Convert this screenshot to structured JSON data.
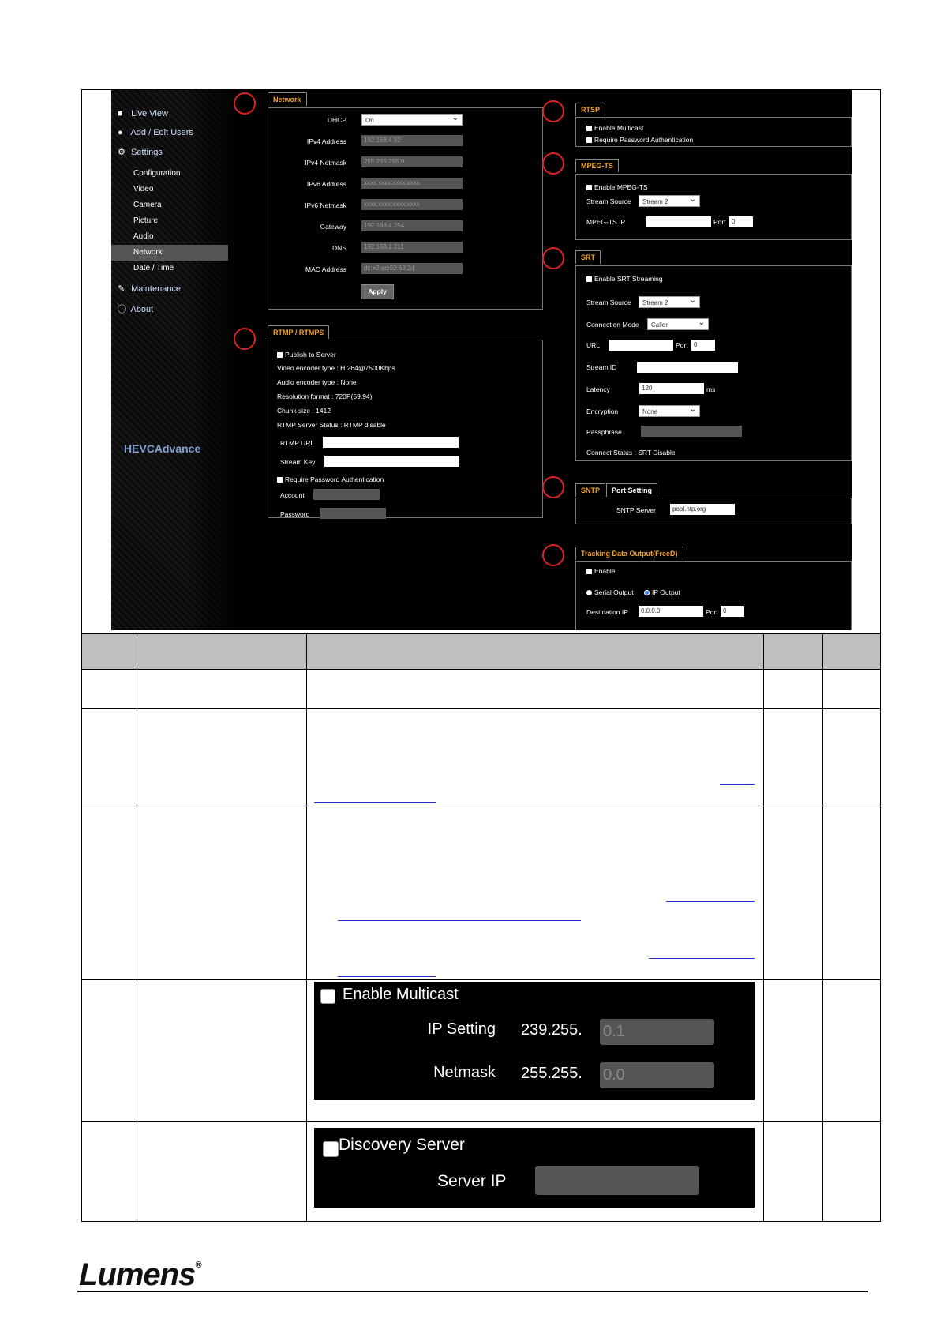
{
  "sidebar": {
    "items": [
      {
        "label": "Live View",
        "icon": "camera-icon"
      },
      {
        "label": "Add / Edit Users",
        "icon": "user-icon"
      },
      {
        "label": "Settings",
        "icon": "gear-icon"
      }
    ],
    "sub": [
      "Configuration",
      "Video",
      "Camera",
      "Picture",
      "Audio",
      "Network",
      "Date / Time"
    ],
    "active": "Network",
    "bottom": [
      {
        "label": "Maintenance",
        "icon": "wrench-icon"
      },
      {
        "label": "About",
        "icon": "info-icon"
      }
    ],
    "logo_text": "HEVCAdvance"
  },
  "network": {
    "tab": "Network",
    "dhcp_label": "DHCP",
    "dhcp_value": "On",
    "ipv4_label": "IPv4 Address",
    "ipv4": "192.168.4.92",
    "netmask_label": "IPv4 Netmask",
    "netmask": "255.255.255.0",
    "ipv6_label": "IPv6 Address",
    "ipv6": "xxxx:xxxx:xxxx:xxxx",
    "ipv6_netmask_label": "IPv6 Netmask",
    "ipv6_netmask": "xxxx:xxxx:xxxx:xxxx",
    "gateway_label": "Gateway",
    "gateway": "192.168.4.254",
    "dns_label": "DNS",
    "dns": "192.168.1.211",
    "mac_label": "MAC Address",
    "mac": "dc:e2:ac:02:63:2d",
    "apply": "Apply"
  },
  "rtmp": {
    "tab": "RTMP / RTMPS",
    "publish": "Publish to Server",
    "video_encoder": "Video encoder type : H.264@7500Kbps",
    "audio_encoder": "Audio encoder type : None",
    "resolution": "Resolution format : 720P(59.94)",
    "chunk": "Chunk size : 1412",
    "status": "RTMP Server Status : RTMP disable",
    "url_label": "RTMP URL",
    "key_label": "Stream Key",
    "require_auth": "Require Password Authentication",
    "account_label": "Account",
    "password_label": "Password"
  },
  "rtsp": {
    "tab": "RTSP",
    "multicast": "Enable Multicast",
    "require_auth": "Require Password Authentication"
  },
  "mpegts": {
    "tab": "MPEG-TS",
    "enable": "Enable MPEG-TS",
    "source_label": "Stream Source",
    "source": "Stream 2",
    "ip_label": "MPEG-TS IP",
    "port_label": "Port",
    "port": "0"
  },
  "srt": {
    "tab": "SRT",
    "enable": "Enable SRT Streaming",
    "source_label": "Stream Source",
    "source": "Stream 2",
    "mode_label": "Connection Mode",
    "mode": "Caller",
    "url_label": "URL",
    "port_label": "Port",
    "port": "0",
    "id_label": "Stream ID",
    "latency_label": "Latency",
    "latency": "120",
    "latency_unit": "ms",
    "enc_label": "Encryption",
    "enc": "None",
    "pass_label": "Passphrase",
    "status": "Connect Status : SRT Disable"
  },
  "sntp": {
    "tab": "SNTP",
    "tab2": "Port Setting",
    "server_label": "SNTP Server",
    "server": "pool.ntp.org"
  },
  "tracking": {
    "tab": "Tracking Data Output(FreeD)",
    "enable": "Enable",
    "serial": "Serial Output",
    "ip_output": "IP Output",
    "dest_label": "Destination IP",
    "dest": "0.0.0.0",
    "port_label": "Port",
    "port": "0"
  },
  "multicast_snap": {
    "enable": "Enable Multicast",
    "ip_label": "IP Setting",
    "ip_prefix": "239.255.",
    "ip_value": "0.1",
    "netmask_label": "Netmask",
    "netmask_prefix": "255.255.",
    "netmask_value": "0.0"
  },
  "discovery_snap": {
    "enable": "Discovery Server",
    "ip_label": "Server IP"
  },
  "footer": {
    "brand": "Lumens",
    "reg": "®"
  }
}
